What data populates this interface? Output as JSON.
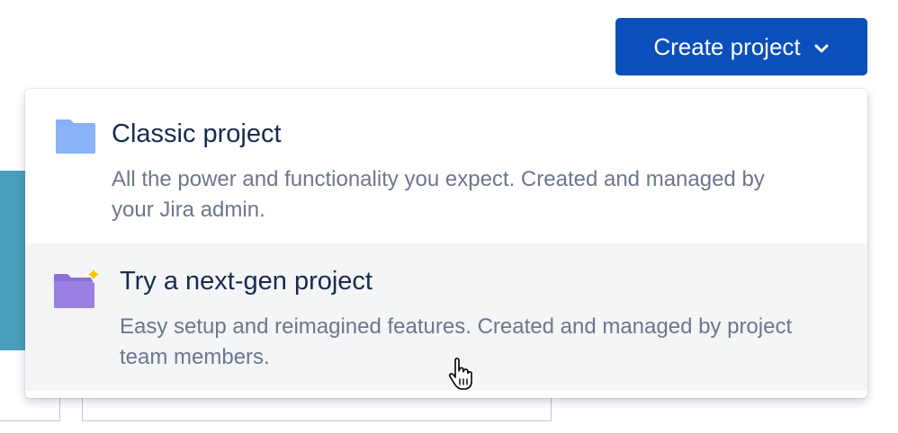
{
  "header": {
    "create_button": {
      "label": "Create project",
      "icon": "chevron-down-icon",
      "color": "#0b4fbc"
    }
  },
  "menu": {
    "items": [
      {
        "title": "Classic project",
        "description": "All the power and functionality you expect. Created and managed by your Jira admin.",
        "icon": "folder-icon",
        "icon_color": "#85aff8"
      },
      {
        "title": "Try a next-gen project",
        "description": "Easy setup and reimagined features. Created and managed by project team members.",
        "icon": "sparkle-folder-icon",
        "icon_color": "#9a80e0",
        "state": "hovered"
      }
    ]
  },
  "colors": {
    "title_text": "#172b4d",
    "description_text": "#6b778c",
    "hover_background": "#f4f5f7",
    "background_card": "#4a9fbc"
  }
}
